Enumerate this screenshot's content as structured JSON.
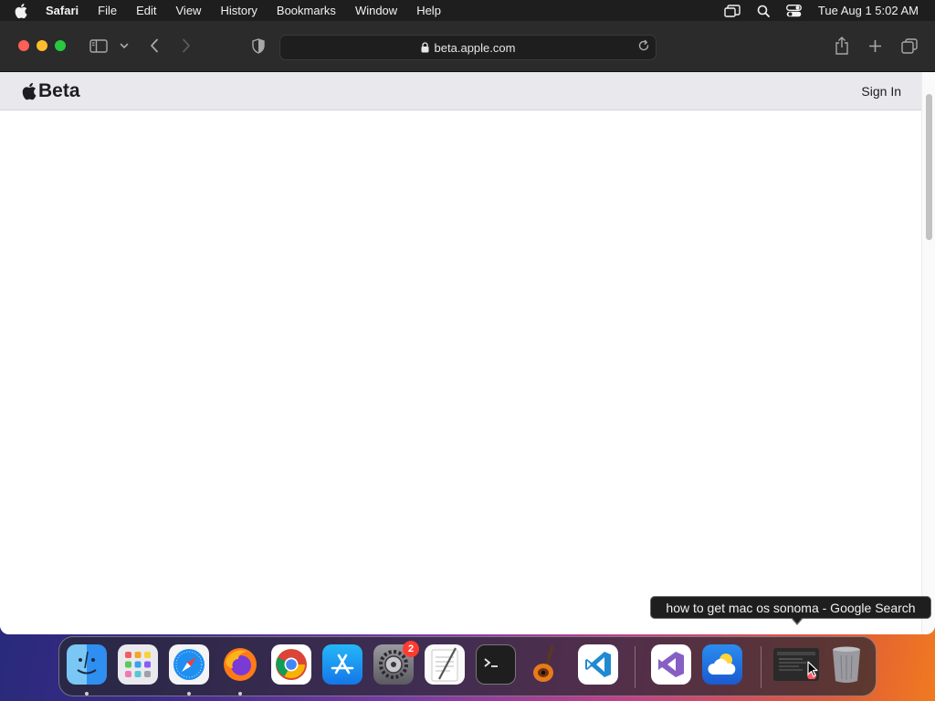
{
  "menubar": {
    "app_name": "Safari",
    "items": [
      "File",
      "Edit",
      "View",
      "History",
      "Bookmarks",
      "Window",
      "Help"
    ],
    "clock": "Tue Aug 1  5:02 AM"
  },
  "toolbar": {
    "url": "beta.apple.com"
  },
  "page": {
    "brand": "Beta",
    "signin": "Sign In"
  },
  "tooltip": {
    "text": "how to get mac os sonoma - Google Search"
  },
  "dock": {
    "settings_badge": "2",
    "apps": [
      "finder-icon",
      "launchpad-icon",
      "safari-icon",
      "firefox-icon",
      "chrome-icon",
      "app-store-icon",
      "system-settings-icon",
      "textedit-icon",
      "terminal-icon",
      "garageband-icon",
      "vscode-icon",
      "visual-studio-icon",
      "weather-icon",
      "minimized-window-thumbnail",
      "trash-icon"
    ]
  },
  "colors": {
    "close": "#ff5f57",
    "minimize": "#febc2e",
    "maximize": "#28c840",
    "badge": "#ff3b30"
  }
}
